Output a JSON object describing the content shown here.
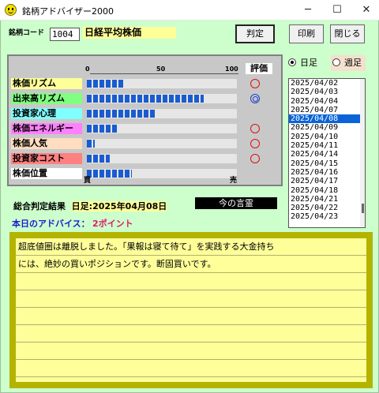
{
  "window": {
    "title": "銘柄アドバイザー2000",
    "buttons": {
      "minimize": "─",
      "maximize": "☐",
      "close": "✕"
    }
  },
  "header": {
    "code_label": "銘柄コード",
    "code_value": "1004",
    "stock_name": "日経平均株価",
    "judge_button": "判定",
    "print_button": "印刷",
    "close_button": "閉じる"
  },
  "scale": {
    "min_label": "0",
    "mid_label": "50",
    "max_label": "100",
    "eval_header": "評価",
    "buy_label": "買",
    "sell_label": "売"
  },
  "indicators": [
    {
      "label": "株価リズム",
      "label_bg": "#ffff99",
      "fill": 0.25,
      "eval": "circle"
    },
    {
      "label": "出来高リズム",
      "label_bg": "#80ff80",
      "fill": 0.78,
      "eval": "double-circle"
    },
    {
      "label": "投資家心理",
      "label_bg": "#80ffff",
      "fill": 0.45,
      "eval": ""
    },
    {
      "label": "株価エネルギー",
      "label_bg": "#ff80ff",
      "fill": 0.21,
      "eval": "circle"
    },
    {
      "label": "株価人気",
      "label_bg": "#ffddc0",
      "fill": 0.05,
      "eval": "circle"
    },
    {
      "label": "投資家コスト",
      "label_bg": "#ff8080",
      "fill": 0.15,
      "eval": "circle"
    },
    {
      "label": "株価位置",
      "label_bg": "#ffffff",
      "fill": 0.3,
      "eval": ""
    }
  ],
  "summary": {
    "label": "総合判定結果",
    "date": "日足:2025年04月08日",
    "quote_button": "今の言霊",
    "advice_label": "本日のアドバイス：",
    "advice_value": "2ポイント"
  },
  "period": {
    "daily": "日足",
    "weekly": "週足",
    "selected": "daily"
  },
  "dates": {
    "items": [
      "2025/04/02",
      "2025/04/03",
      "2025/04/04",
      "2025/04/07",
      "2025/04/08",
      "2025/04/09",
      "2025/04/10",
      "2025/04/11",
      "2025/04/14",
      "2025/04/15",
      "2025/04/16",
      "2025/04/17",
      "2025/04/18",
      "2025/04/21",
      "2025/04/22",
      "2025/04/23"
    ],
    "selected": "2025/04/08"
  },
  "message": {
    "lines": [
      "超底値圏は離脱しました。「果報は寝て待て」を実践する大金持ち",
      "には、絶妙の買いポジションです。断固買いです。"
    ]
  }
}
